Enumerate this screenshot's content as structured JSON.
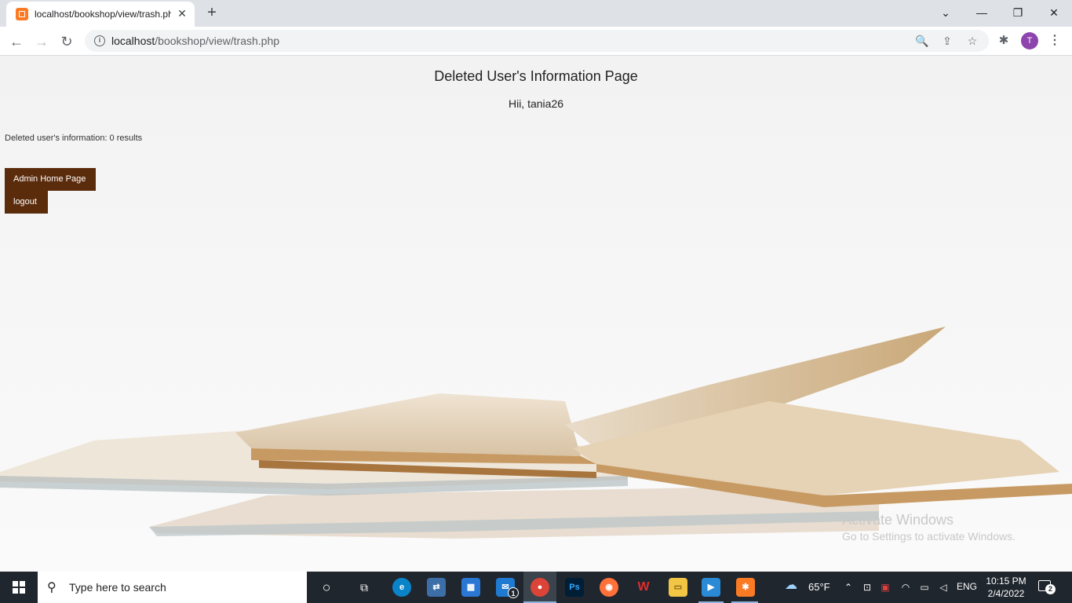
{
  "browser": {
    "tab": {
      "title": "localhost/bookshop/view/trash.php",
      "favicon": "xampp-icon"
    },
    "url": {
      "host": "localhost",
      "path": "/bookshop/view/trash.php"
    },
    "profile_initial": "T",
    "accent": "#8e44ad"
  },
  "page": {
    "heading": "Deleted User's Information Page",
    "greeting": "Hii, tania26",
    "result_text": "Deleted user's information: 0 results",
    "buttons": {
      "admin_home": "Admin Home Page",
      "logout": "logout"
    },
    "button_color": "#5b2c0c"
  },
  "watermark": {
    "title": "Activate Windows",
    "subtitle": "Go to Settings to activate Windows."
  },
  "taskbar": {
    "search_placeholder": "Type here to search",
    "weather": "65°F",
    "language": "ENG",
    "time": "10:15 PM",
    "date": "2/4/2022",
    "mail_badge": "1",
    "notification_count": "2",
    "apps": [
      "cortana",
      "task-view",
      "edge",
      "file-transfer",
      "microsoft-store",
      "mail",
      "chrome",
      "photoshop",
      "firefox",
      "wps-office",
      "file-explorer",
      "media-player",
      "xampp"
    ]
  }
}
